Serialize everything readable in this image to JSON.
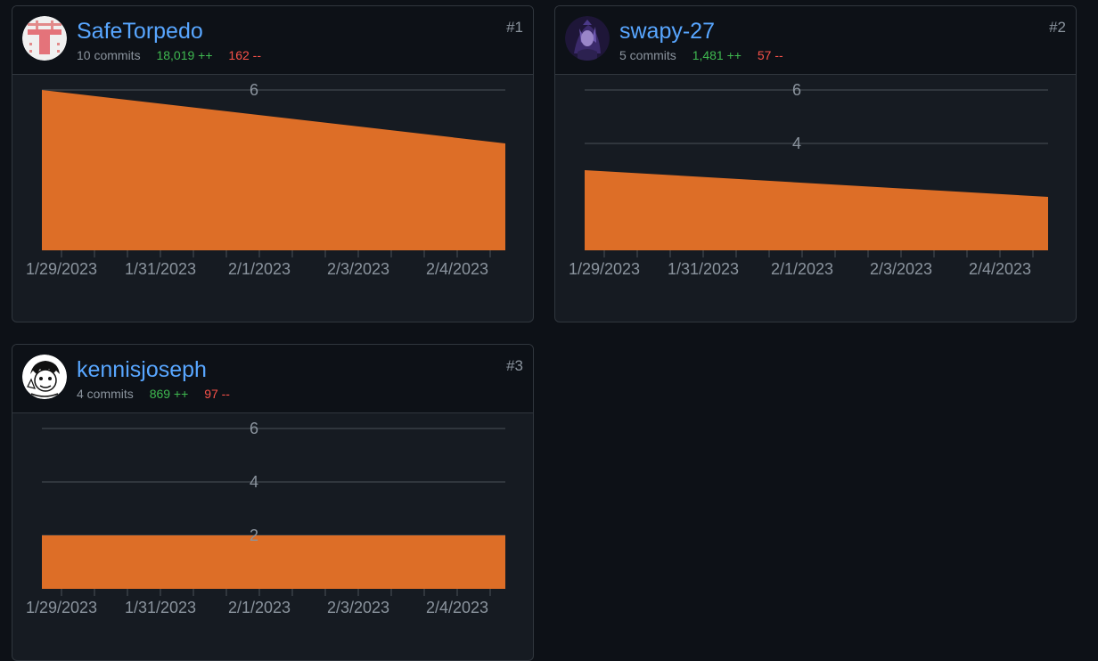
{
  "contributors": [
    {
      "username": "SafeTorpedo",
      "commits": "10 commits",
      "additions": "18,019 ++",
      "deletions": "162 --",
      "rank": "#1",
      "avatar": "letter-t-avatar",
      "chart_data": {
        "type": "area",
        "x": [
          "1/29/2023",
          "2/5/2023"
        ],
        "y": [
          6,
          4
        ],
        "ylim": [
          0,
          6
        ],
        "yticks_visible": [
          6
        ],
        "xtick_labels": [
          "1/29/2023",
          "1/31/2023",
          "2/1/2023",
          "2/3/2023",
          "2/4/2023"
        ],
        "grid": true,
        "color": "#dd6e27"
      }
    },
    {
      "username": "swapy-27",
      "commits": "5 commits",
      "additions": "1,481 ++",
      "deletions": "57 --",
      "rank": "#2",
      "avatar": "dark-character-avatar",
      "chart_data": {
        "type": "area",
        "x": [
          "1/29/2023",
          "2/5/2023"
        ],
        "y": [
          3,
          2
        ],
        "ylim": [
          0,
          6
        ],
        "yticks_visible": [
          6,
          4
        ],
        "xtick_labels": [
          "1/29/2023",
          "1/31/2023",
          "2/1/2023",
          "2/3/2023",
          "2/4/2023"
        ],
        "grid": true,
        "color": "#dd6e27"
      }
    },
    {
      "username": "kennisjoseph",
      "commits": "4 commits",
      "additions": "869 ++",
      "deletions": "97 --",
      "rank": "#3",
      "avatar": "manga-character-avatar",
      "chart_data": {
        "type": "area",
        "x": [
          "1/29/2023",
          "2/5/2023"
        ],
        "y": [
          2,
          2
        ],
        "ylim": [
          0,
          6
        ],
        "yticks_visible": [
          6,
          4,
          2
        ],
        "xtick_labels": [
          "1/29/2023",
          "1/31/2023",
          "2/1/2023",
          "2/3/2023",
          "2/4/2023"
        ],
        "grid": true,
        "color": "#dd6e27"
      }
    }
  ],
  "colors": {
    "background": "#0d1117",
    "card": "#161b22",
    "border": "#30363d",
    "link": "#58a6ff",
    "muted": "#8b949e",
    "add": "#3fb950",
    "del": "#f85149",
    "area": "#dd6e27"
  }
}
